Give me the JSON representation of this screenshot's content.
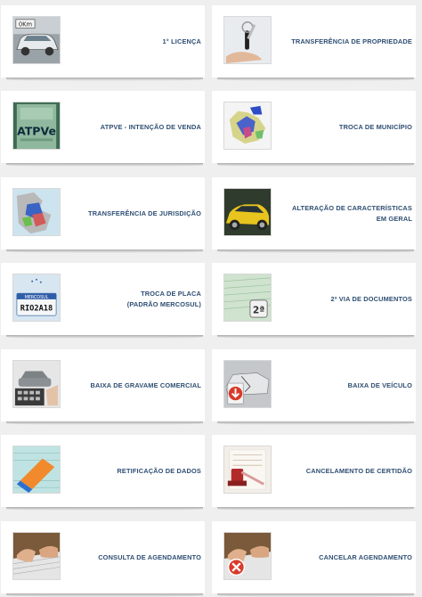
{
  "services": [
    {
      "label": "1° LICENÇA",
      "icon": "new-car-icon"
    },
    {
      "label": "TRANSFERÊNCIA DE PROPRIEDADE",
      "icon": "car-keys-icon"
    },
    {
      "label": "ATPVE - INTENÇÃO DE VENDA",
      "icon": "atpve-document-icon",
      "icon_text": "ATPVe"
    },
    {
      "label": "TROCA DE MUNICÍPIO",
      "icon": "municipality-map-icon"
    },
    {
      "label": "TRANSFERÊNCIA DE JURISDIÇÃO",
      "icon": "jurisdiction-map-icon"
    },
    {
      "label": "ALTERAÇÃO DE CARACTERÍSTICAS\nEM GERAL",
      "icon": "yellow-car-icon"
    },
    {
      "label": "TROCA DE PLACA\n(PADRÃO MERCOSUL)",
      "icon": "mercosul-plate-icon",
      "icon_text": "RIO2A18"
    },
    {
      "label": "2ª VIA DE DOCUMENTOS",
      "icon": "duplicate-document-icon",
      "icon_text": "2ª"
    },
    {
      "label": "BAIXA DE GRAVAME COMERCIAL",
      "icon": "calculator-car-icon"
    },
    {
      "label": "BAIXA DE VEÍCULO",
      "icon": "wrecked-car-icon"
    },
    {
      "label": "RETIFICAÇÃO DE DADOS",
      "icon": "eraser-form-icon"
    },
    {
      "label": "CANCELAMENTO DE CERTIDÃO",
      "icon": "stamp-icon"
    },
    {
      "label": "CONSULTA DE AGENDAMENTO",
      "icon": "keyboard-hands-icon"
    },
    {
      "label": "CANCELAR AGENDAMENTO",
      "icon": "cancel-keyboard-icon"
    }
  ],
  "colors": {
    "label": "#2f4f73",
    "background": "#efefef",
    "card": "#ffffff"
  }
}
